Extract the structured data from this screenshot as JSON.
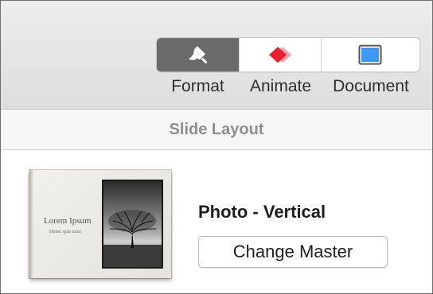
{
  "toolbar": {
    "tabs": [
      {
        "label": "Format",
        "icon": "paintbrush-icon",
        "selected": true
      },
      {
        "label": "Animate",
        "icon": "animate-diamonds-icon",
        "selected": false
      },
      {
        "label": "Document",
        "icon": "document-window-icon",
        "selected": false
      }
    ]
  },
  "section": {
    "title": "Slide Layout"
  },
  "master": {
    "thumbnail_title": "Lorem Ipsum",
    "thumbnail_subtitle": "Donec quis nunc",
    "name": "Photo - Vertical",
    "change_button_label": "Change Master"
  },
  "colors": {
    "selected_segment": "#6a6a6a",
    "animate_icon_red": "#e8202e",
    "animate_icon_pink": "#f4a0a6",
    "document_icon_blue": "#3f99f2",
    "section_title": "#8e8e8e"
  }
}
